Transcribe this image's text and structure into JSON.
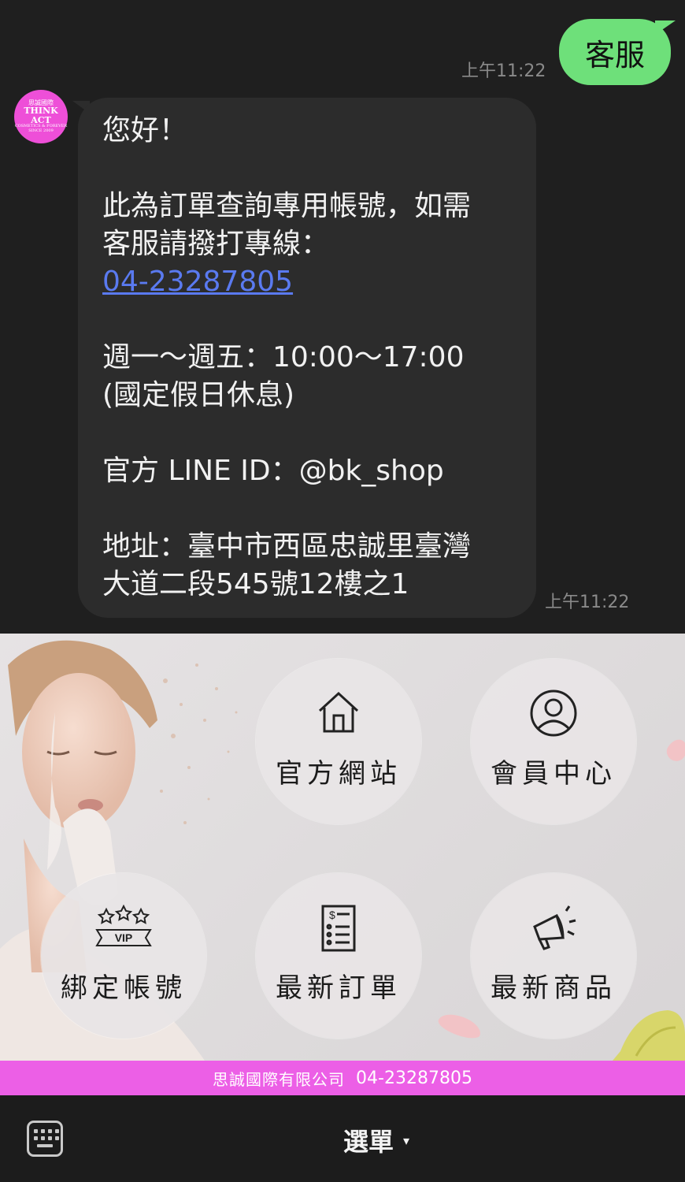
{
  "chat": {
    "sent_message": "客服",
    "sent_time": "上午11:22",
    "avatar_text": {
      "line1": "思誠國際",
      "line2": "THINK",
      "line3": "ACT",
      "line4": "COSMETICS & FOREVER",
      "line5": "SINCE 2009"
    },
    "received_lines": {
      "greeting": "您好！",
      "info_1": "此為訂單查詢專用帳號，如需",
      "info_2": "客服請撥打專線：",
      "phone": "04-23287805",
      "hours_1": "週一～週五：10:00～17:00",
      "hours_2": "(國定假日休息)",
      "line_id": "官方 LINE ID：@bk_shop",
      "address_1": "地址：臺中市西區忠誠里臺灣",
      "address_2": "大道二段545號12樓之1"
    },
    "received_time": "上午11:22"
  },
  "rich_menu": {
    "buttons": [
      {
        "label": "官方網站",
        "icon": "home-icon"
      },
      {
        "label": "會員中心",
        "icon": "user-icon"
      },
      {
        "label": "綁定帳號",
        "icon": "vip-icon"
      },
      {
        "label": "最新訂單",
        "icon": "receipt-icon"
      },
      {
        "label": "最新商品",
        "icon": "megaphone-icon"
      }
    ],
    "footer_company": "思誠國際有限公司",
    "footer_phone": "04-23287805",
    "accent_color": "#ec5fe6"
  },
  "bottom_bar": {
    "menu_label": "選單",
    "caret": "▾",
    "keyboard_icon": "keyboard-icon"
  }
}
